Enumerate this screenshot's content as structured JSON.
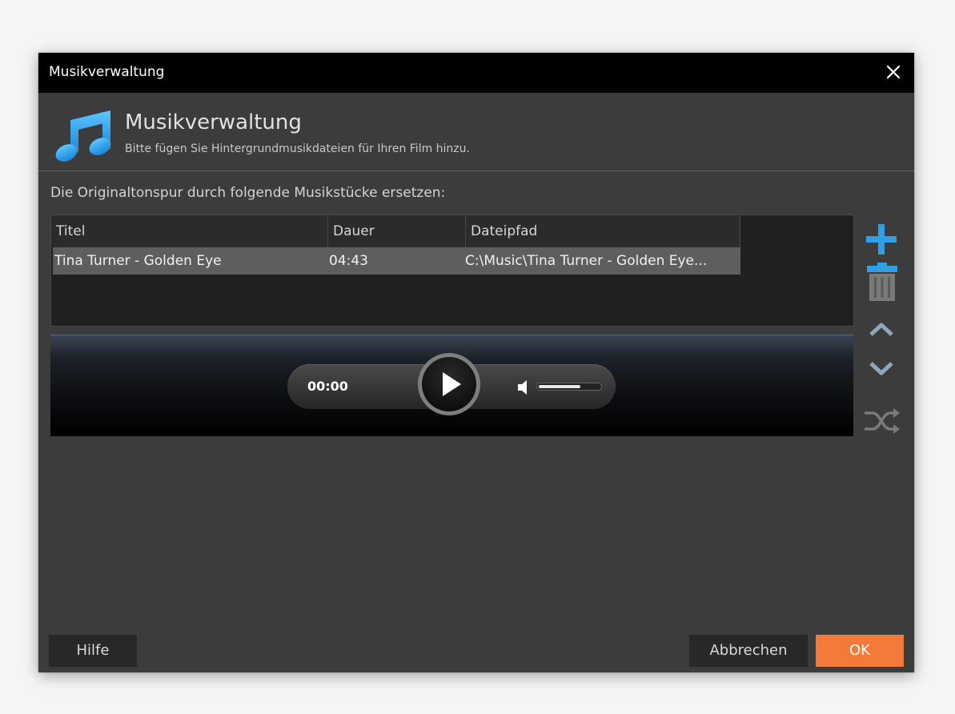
{
  "window": {
    "title": "Musikverwaltung",
    "close_icon": "close-icon"
  },
  "header": {
    "icon": "music-note-icon",
    "title": "Musikverwaltung",
    "subtitle": "Bitte fügen Sie Hintergrundmusikdateien für Ihren Film hinzu."
  },
  "intro_text": "Die Originaltonspur durch folgende Musikstücke ersetzen:",
  "table": {
    "columns": [
      "Titel",
      "Dauer",
      "Dateipfad"
    ],
    "rows": [
      {
        "title": "Tina Turner - Golden Eye",
        "duration": "04:43",
        "path": "C:\\Music\\Tina Turner - Golden Eye..."
      }
    ]
  },
  "player": {
    "time": "00:00",
    "volume_fraction": 0.7
  },
  "side_actions": [
    "add-icon",
    "trash-icon",
    "move-up-icon",
    "move-down-icon",
    "shuffle-icon"
  ],
  "buttons": {
    "help": "Hilfe",
    "cancel": "Abbrechen",
    "ok": "OK"
  },
  "colors": {
    "accent_blue": "#2f9fe8",
    "ok_orange": "#f47a3a",
    "title_bar": "#000000",
    "dialog_bg": "#3c3c3c"
  }
}
